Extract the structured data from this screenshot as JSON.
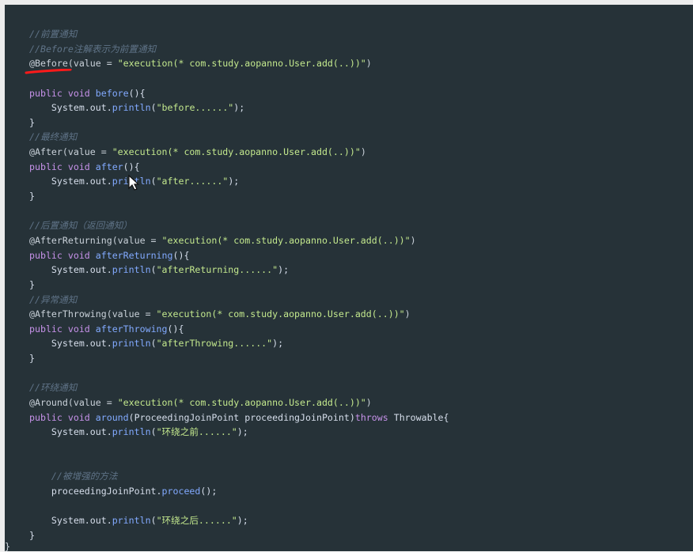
{
  "code_lines": [
    {
      "id": "l1",
      "parts": [
        {
          "t": "//前置通知",
          "c": "comment"
        }
      ]
    },
    {
      "id": "l2",
      "parts": [
        {
          "t": "//Before注解表示为前置通知",
          "c": "comment"
        }
      ]
    },
    {
      "id": "l3",
      "parts": [
        {
          "t": "@Before(value = ",
          "c": "annotation"
        },
        {
          "t": "\"execution(* com.study.aopanno.User.add(..))\"",
          "c": "string"
        },
        {
          "t": ")",
          "c": "annotation"
        }
      ]
    },
    {
      "id": "l4",
      "parts": [
        {
          "t": "",
          "c": "plain"
        }
      ]
    },
    {
      "id": "l5",
      "parts": [
        {
          "t": "public void ",
          "c": "kw"
        },
        {
          "t": "before",
          "c": "method"
        },
        {
          "t": "(){",
          "c": "plain"
        }
      ]
    },
    {
      "id": "l6",
      "parts": [
        {
          "t": "    System.out.",
          "c": "plain"
        },
        {
          "t": "println",
          "c": "method"
        },
        {
          "t": "(",
          "c": "plain"
        },
        {
          "t": "\"before......\"",
          "c": "string"
        },
        {
          "t": ");",
          "c": "plain"
        }
      ]
    },
    {
      "id": "l7",
      "parts": [
        {
          "t": "}",
          "c": "plain"
        }
      ]
    },
    {
      "id": "l8",
      "parts": [
        {
          "t": "//最终通知",
          "c": "comment"
        }
      ]
    },
    {
      "id": "l9",
      "parts": [
        {
          "t": "@After(value = ",
          "c": "annotation"
        },
        {
          "t": "\"execution(* com.study.aopanno.User.add(..))\"",
          "c": "string"
        },
        {
          "t": ")",
          "c": "annotation"
        }
      ]
    },
    {
      "id": "l10",
      "parts": [
        {
          "t": "public void ",
          "c": "kw"
        },
        {
          "t": "after",
          "c": "method"
        },
        {
          "t": "(){",
          "c": "plain"
        }
      ]
    },
    {
      "id": "l11",
      "parts": [
        {
          "t": "    System.out.",
          "c": "plain"
        },
        {
          "t": "println",
          "c": "method"
        },
        {
          "t": "(",
          "c": "plain"
        },
        {
          "t": "\"after......\"",
          "c": "string"
        },
        {
          "t": ");",
          "c": "plain"
        }
      ]
    },
    {
      "id": "l12",
      "parts": [
        {
          "t": "}",
          "c": "plain"
        }
      ]
    },
    {
      "id": "l13",
      "parts": [
        {
          "t": "",
          "c": "plain"
        }
      ]
    },
    {
      "id": "l14",
      "parts": [
        {
          "t": "//后置通知（返回通知）",
          "c": "comment"
        }
      ]
    },
    {
      "id": "l15",
      "parts": [
        {
          "t": "@AfterReturning(value = ",
          "c": "annotation"
        },
        {
          "t": "\"execution(* com.study.aopanno.User.add(..))\"",
          "c": "string"
        },
        {
          "t": ")",
          "c": "annotation"
        }
      ]
    },
    {
      "id": "l16",
      "parts": [
        {
          "t": "public void ",
          "c": "kw"
        },
        {
          "t": "afterReturning",
          "c": "method"
        },
        {
          "t": "(){",
          "c": "plain"
        }
      ]
    },
    {
      "id": "l17",
      "parts": [
        {
          "t": "    System.out.",
          "c": "plain"
        },
        {
          "t": "println",
          "c": "method"
        },
        {
          "t": "(",
          "c": "plain"
        },
        {
          "t": "\"afterReturning......\"",
          "c": "string"
        },
        {
          "t": ");",
          "c": "plain"
        }
      ]
    },
    {
      "id": "l18",
      "parts": [
        {
          "t": "}",
          "c": "plain"
        }
      ]
    },
    {
      "id": "l19",
      "parts": [
        {
          "t": "//异常通知",
          "c": "comment"
        }
      ]
    },
    {
      "id": "l20",
      "parts": [
        {
          "t": "@AfterThrowing(value = ",
          "c": "annotation"
        },
        {
          "t": "\"execution(* com.study.aopanno.User.add(..))\"",
          "c": "string"
        },
        {
          "t": ")",
          "c": "annotation"
        }
      ]
    },
    {
      "id": "l21",
      "parts": [
        {
          "t": "public void ",
          "c": "kw"
        },
        {
          "t": "afterThrowing",
          "c": "method"
        },
        {
          "t": "(){",
          "c": "plain"
        }
      ]
    },
    {
      "id": "l22",
      "parts": [
        {
          "t": "    System.out.",
          "c": "plain"
        },
        {
          "t": "println",
          "c": "method"
        },
        {
          "t": "(",
          "c": "plain"
        },
        {
          "t": "\"afterThrowing......\"",
          "c": "string"
        },
        {
          "t": ");",
          "c": "plain"
        }
      ]
    },
    {
      "id": "l23",
      "parts": [
        {
          "t": "}",
          "c": "plain"
        }
      ]
    },
    {
      "id": "l24",
      "parts": [
        {
          "t": "",
          "c": "plain"
        }
      ]
    },
    {
      "id": "l25",
      "parts": [
        {
          "t": "//环绕通知",
          "c": "comment"
        }
      ]
    },
    {
      "id": "l26",
      "parts": [
        {
          "t": "@Around(value = ",
          "c": "annotation"
        },
        {
          "t": "\"execution(* com.study.aopanno.User.add(..))\"",
          "c": "string"
        },
        {
          "t": ")",
          "c": "annotation"
        }
      ]
    },
    {
      "id": "l27",
      "parts": [
        {
          "t": "public void ",
          "c": "kw"
        },
        {
          "t": "around",
          "c": "method"
        },
        {
          "t": "(ProceedingJoinPoint proceedingJoinPoint)",
          "c": "plain"
        },
        {
          "t": "throws ",
          "c": "kw"
        },
        {
          "t": "Throwable{",
          "c": "plain"
        }
      ]
    },
    {
      "id": "l28",
      "parts": [
        {
          "t": "    System.out.",
          "c": "plain"
        },
        {
          "t": "println",
          "c": "method"
        },
        {
          "t": "(",
          "c": "plain"
        },
        {
          "t": "\"环绕之前......\"",
          "c": "string"
        },
        {
          "t": ");",
          "c": "plain"
        }
      ]
    },
    {
      "id": "l29",
      "parts": [
        {
          "t": "",
          "c": "plain"
        }
      ]
    },
    {
      "id": "l30",
      "parts": [
        {
          "t": "",
          "c": "plain"
        }
      ]
    },
    {
      "id": "l31",
      "parts": [
        {
          "t": "    //被增强的方法",
          "c": "comment"
        }
      ]
    },
    {
      "id": "l32",
      "parts": [
        {
          "t": "    proceedingJoinPoint.",
          "c": "plain"
        },
        {
          "t": "proceed",
          "c": "method"
        },
        {
          "t": "();",
          "c": "plain"
        }
      ]
    },
    {
      "id": "l33",
      "parts": [
        {
          "t": "",
          "c": "plain"
        }
      ]
    },
    {
      "id": "l34",
      "parts": [
        {
          "t": "    System.out.",
          "c": "plain"
        },
        {
          "t": "println",
          "c": "method"
        },
        {
          "t": "(",
          "c": "plain"
        },
        {
          "t": "\"环绕之后......\"",
          "c": "string"
        },
        {
          "t": ");",
          "c": "plain"
        }
      ]
    },
    {
      "id": "l35",
      "parts": [
        {
          "t": "}",
          "c": "plain"
        }
      ]
    }
  ],
  "edge_brace": "}",
  "colors": {
    "background": "#263238",
    "comment": "#5f7387",
    "keyword": "#c792ea",
    "method": "#82aaff",
    "string": "#c3e88d",
    "text": "#d6deeb",
    "underline_marker": "#ff0000"
  },
  "icons": {
    "cursor": "mouse-pointer-icon",
    "underline": "red-underline-annotation"
  }
}
